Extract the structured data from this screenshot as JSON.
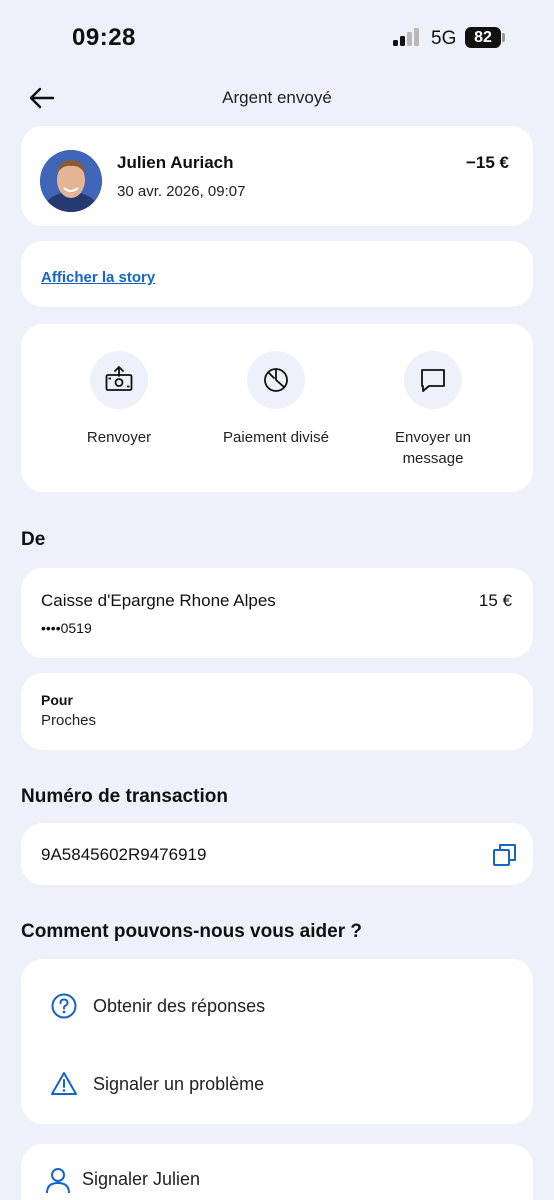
{
  "status_bar": {
    "time": "09:28",
    "network": "5G",
    "battery": "82"
  },
  "header": {
    "title": "Argent envoyé",
    "back_icon": "arrow-left-icon"
  },
  "transaction": {
    "name": "Julien Auriach",
    "date": "30 avr. 2026, 09:07",
    "amount": "−15 €"
  },
  "story": {
    "link": "Afficher la story"
  },
  "actions": [
    {
      "label": "Renvoyer",
      "icon": "send-money-icon"
    },
    {
      "label": "Paiement divisé",
      "icon": "split-pie-icon"
    },
    {
      "label": "Envoyer un message",
      "icon": "message-icon"
    }
  ],
  "from": {
    "title": "De",
    "bank_name": "Caisse d'Epargne Rhone Alpes",
    "account": "••••0519",
    "amount": "15 €"
  },
  "purpose": {
    "label": "Pour",
    "value": "Proches"
  },
  "transaction_number": {
    "title": "Numéro de transaction",
    "id": "9A5845602R9476919"
  },
  "help": {
    "title": "Comment pouvons-nous vous aider ?",
    "items": [
      {
        "label": "Obtenir des réponses",
        "icon": "question-circle-icon"
      },
      {
        "label": "Signaler un problème",
        "icon": "warning-triangle-icon"
      }
    ]
  },
  "report": {
    "label": "Signaler Julien",
    "icon": "user-icon"
  },
  "colors": {
    "background": "#eef1fa",
    "accent": "#1565c8",
    "card": "#ffffff"
  }
}
